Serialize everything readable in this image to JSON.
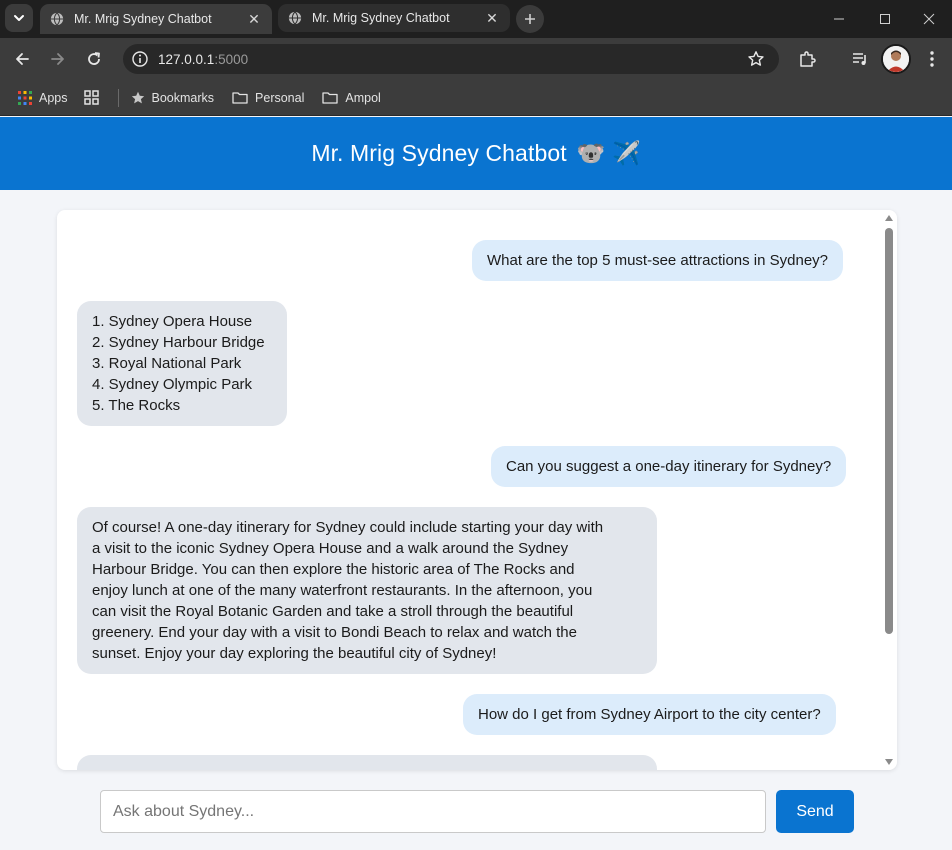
{
  "browser": {
    "tabs": [
      {
        "title": "Mr. Mrig Sydney Chatbot",
        "active": true
      },
      {
        "title": "Mr. Mrig Sydney Chatbot",
        "active": false
      }
    ],
    "url_host": "127.0.0.1",
    "url_port": ":5000",
    "bookmarks": {
      "apps_label": "Apps",
      "items": [
        "Bookmarks",
        "Personal",
        "Ampol"
      ]
    }
  },
  "app": {
    "title": "Mr. Mrig Sydney Chatbot",
    "title_emoji": "🐨 ✈️",
    "accent_color": "#0a74d0"
  },
  "chat": {
    "messages": [
      {
        "role": "user",
        "text": "What are the top 5 must-see attractions in Sydney?"
      },
      {
        "role": "bot",
        "text": "1. Sydney Opera House\n2. Sydney Harbour Bridge\n3. Royal National Park\n4. Sydney Olympic Park\n5. The Rocks"
      },
      {
        "role": "user",
        "text": "Can you suggest a one-day itinerary for Sydney?"
      },
      {
        "role": "bot",
        "text": "Of course! A one-day itinerary for Sydney could include starting your day with\na visit to the iconic Sydney Opera House and a walk around the Sydney\nHarbour Bridge. You can then explore the historic area of The Rocks and\nenjoy lunch at one of the many waterfront restaurants. In the afternoon, you\ncan visit the Royal Botanic Garden and take a stroll through the beautiful\ngreenery. End your day with a visit to Bondi Beach to relax and watch the\nsunset. Enjoy your day exploring the beautiful city of Sydney!"
      },
      {
        "role": "user",
        "text": "How do I get from Sydney Airport to the city center?"
      },
      {
        "role": "bot",
        "text": ""
      }
    ]
  },
  "composer": {
    "placeholder": "Ask about Sydney...",
    "value": "",
    "send_label": "Send"
  }
}
